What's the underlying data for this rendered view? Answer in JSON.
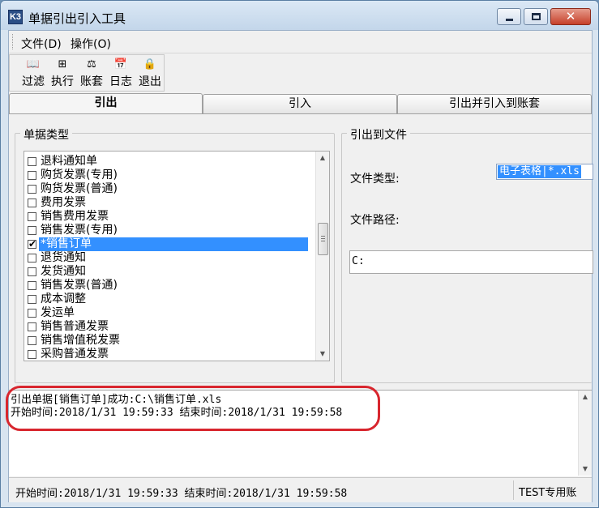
{
  "window": {
    "title": "单据引出引入工具",
    "icon_text": "K3",
    "controls": {
      "minimize": "–",
      "maximize": "□",
      "close": "✕"
    }
  },
  "menubar": {
    "items": [
      {
        "label": "文件(D)"
      },
      {
        "label": "操作(O)"
      }
    ]
  },
  "toolbar": {
    "buttons": [
      {
        "label": "过滤",
        "icon": "book-icon",
        "glyph": "📖"
      },
      {
        "label": "执行",
        "icon": "grid-icon",
        "glyph": "⊞"
      },
      {
        "label": "账套",
        "icon": "ledger-icon",
        "glyph": "⚖"
      },
      {
        "label": "日志",
        "icon": "calendar-icon",
        "glyph": "📅"
      },
      {
        "label": "退出",
        "icon": "exit-icon",
        "glyph": "🔒"
      }
    ]
  },
  "tabs": [
    {
      "label": "引出",
      "active": true
    },
    {
      "label": "引入",
      "active": false
    },
    {
      "label": "引出并引入到账套",
      "active": false
    }
  ],
  "doc_types": {
    "legend": "单据类型",
    "items": [
      {
        "label": "退料通知单",
        "checked": false
      },
      {
        "label": "购货发票(专用)",
        "checked": false
      },
      {
        "label": "购货发票(普通)",
        "checked": false
      },
      {
        "label": "费用发票",
        "checked": false
      },
      {
        "label": "销售费用发票",
        "checked": false
      },
      {
        "label": "销售发票(专用)",
        "checked": false
      },
      {
        "label": "*销售订单",
        "checked": true,
        "selected": true
      },
      {
        "label": "退货通知",
        "checked": false
      },
      {
        "label": "发货通知",
        "checked": false
      },
      {
        "label": "销售发票(普通)",
        "checked": false
      },
      {
        "label": "成本调整",
        "checked": false
      },
      {
        "label": "发运单",
        "checked": false
      },
      {
        "label": "销售普通发票",
        "checked": false
      },
      {
        "label": "销售增值税发票",
        "checked": false
      },
      {
        "label": "采购普通发票",
        "checked": false
      }
    ],
    "check_mark": "✔"
  },
  "export_to_file": {
    "legend": "引出到文件",
    "file_type_label": "文件类型:",
    "file_type_value": "电子表格|*.xls",
    "file_path_label": "文件路径:",
    "file_path_value": "C:"
  },
  "log": {
    "lines": [
      "引出单据[销售订单]成功:C:\\销售订单.xls",
      "开始时间:2018/1/31 19:59:33 结束时间:2018/1/31 19:59:58"
    ]
  },
  "statusbar": {
    "time_text": "开始时间:2018/1/31 19:59:33 结束时间:2018/1/31 19:59:58",
    "right_text": "TEST专用账"
  }
}
